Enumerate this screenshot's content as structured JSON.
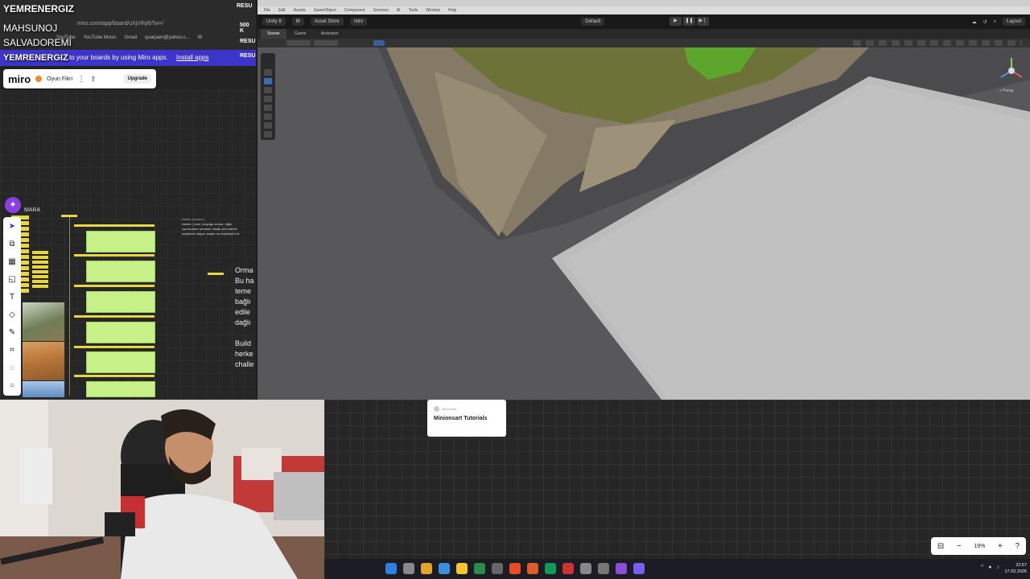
{
  "overlay": {
    "names": [
      "YEMRENERGIZ",
      "MAHSUNOJ",
      "SALVADOREMI",
      "YEMRENERGIZ"
    ],
    "right_tags": [
      "RESU",
      "500 K",
      "RESU",
      "RESU"
    ]
  },
  "browser": {
    "address": "miro.com/app/board/uXjVIhjIbTw=/",
    "bookmarks": [
      "YouTube",
      "YouTube Music",
      "Gmail",
      "quarjaen@yahoo.c...",
      "W"
    ]
  },
  "miro": {
    "banner_text": "to your boards by using Miro apps.",
    "banner_link": "Install apps",
    "logo": "miro",
    "board_name": "Oyun Fikri",
    "upgrade_label": "Upgrade",
    "section_label": "MARA",
    "note_heading": "Admin (Kurucu)",
    "note_body": "Admin ( host ) duyuğu zorum, diğer oyuncuların randomi olarak yeni admin seçilmesi olayını araştır ve implement et.",
    "cut_text_lines": [
      "Orma",
      "Bu ha",
      "teme",
      "bağlı",
      "edile",
      "dağlı",
      "",
      "Build",
      "herke",
      "challe"
    ]
  },
  "unity": {
    "app_label": "Unity 6",
    "account_label": "M",
    "asset_store": "Asset Store",
    "miro_label": "miro",
    "layout_label": "Default",
    "layout_right": "Layout",
    "menu_items": [
      "File",
      "Edit",
      "Assets",
      "GameObject",
      "Component",
      "Services",
      "AI",
      "Tools",
      "Window",
      "Help"
    ],
    "tabs": [
      "Scene",
      "Game",
      "Animator"
    ],
    "persp_label": "< Persp"
  },
  "bottom_miro": {
    "card_small": "Minionsart",
    "card_title": "Minionsart Tutorials",
    "zoom": "19%"
  },
  "taskbar": {
    "time": "22:57",
    "date": "17.03.2026",
    "icon_colors": [
      "#2d7fe0",
      "#888",
      "#e0a52a",
      "#3c8fd8",
      "#f3c530",
      "#2d8a4a",
      "#666",
      "#e94c25",
      "#e05a2a",
      "#0f9a5a",
      "#c33",
      "#888",
      "#777",
      "#8b4fd6",
      "#7b5cf0"
    ]
  },
  "colors": {
    "miro_accent": "#3d34c9",
    "sticky_green": "#c8f089",
    "sticky_yellow": "#e8d544"
  }
}
